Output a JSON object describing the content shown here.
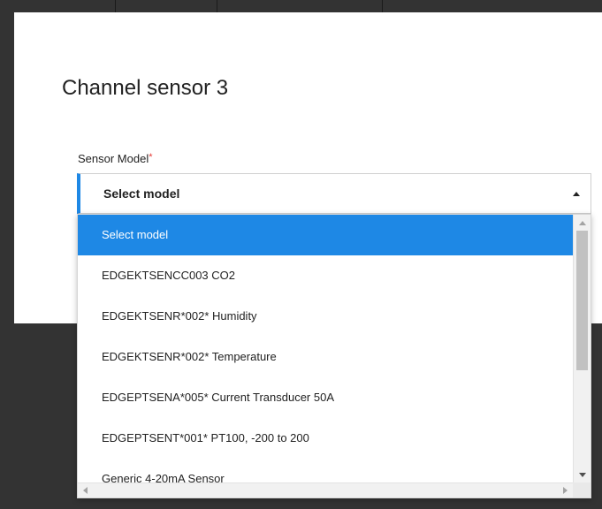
{
  "modal": {
    "title": "Channel sensor 3",
    "field_label": "Sensor Model",
    "required_mark": "*"
  },
  "select": {
    "value": "Select model",
    "is_open": true
  },
  "dropdown": {
    "options": [
      {
        "label": "Select model",
        "selected": true
      },
      {
        "label": "EDGEKTSENCC003 CO2",
        "selected": false
      },
      {
        "label": "EDGEKTSENR*002* Humidity",
        "selected": false
      },
      {
        "label": "EDGEKTSENR*002* Temperature",
        "selected": false
      },
      {
        "label": "EDGEPTSENA*005* Current Transducer 50A",
        "selected": false
      },
      {
        "label": "EDGEPTSENT*001* PT100, -200 to 200",
        "selected": false
      },
      {
        "label": "Generic 4-20mA Sensor",
        "selected": false
      }
    ]
  },
  "colors": {
    "accent": "#1e88e5",
    "required": "#e53935",
    "backdrop": "#333333"
  }
}
